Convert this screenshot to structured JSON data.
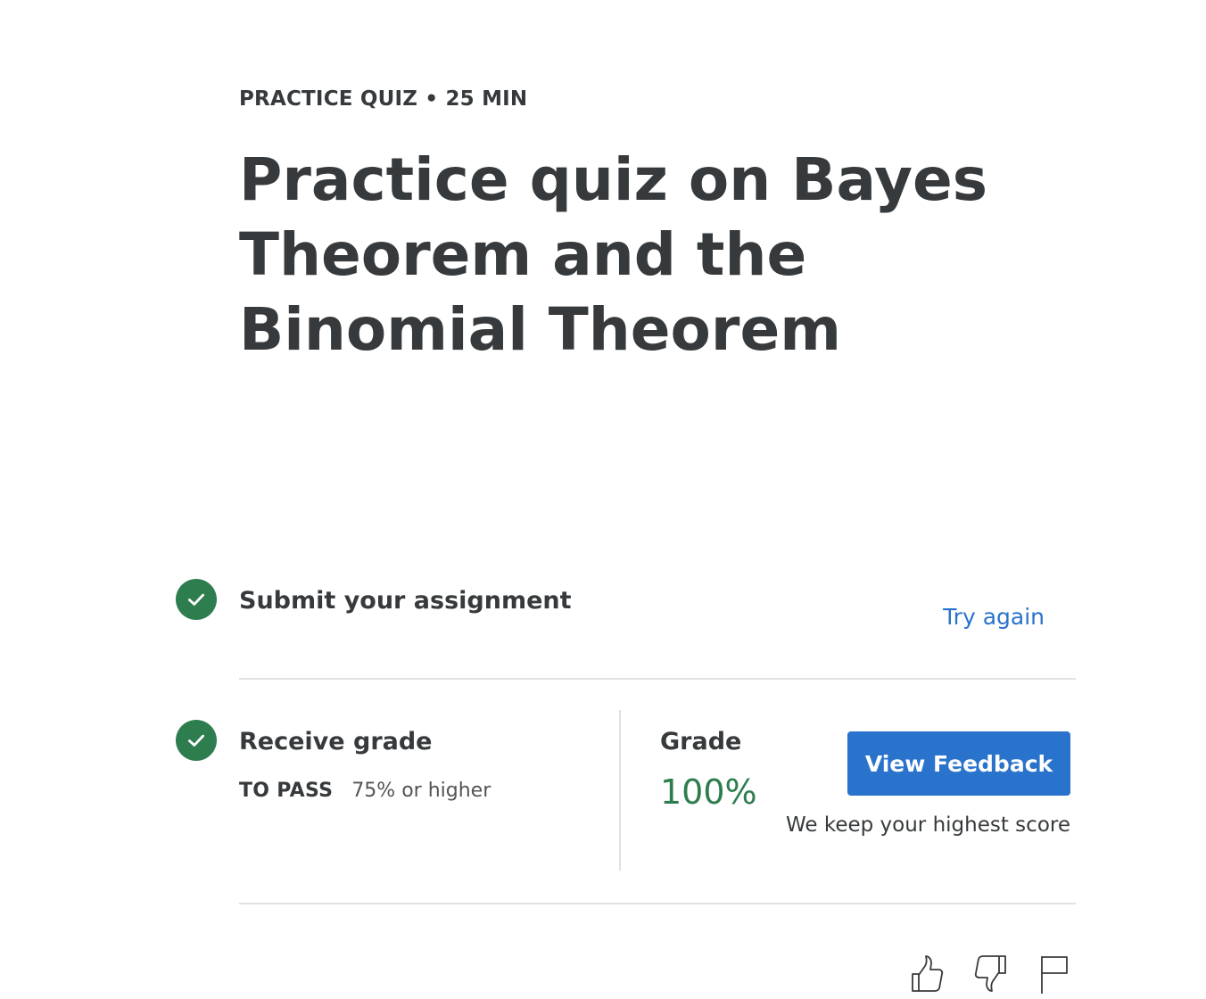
{
  "header": {
    "eyebrow": "PRACTICE QUIZ • 25 MIN",
    "title": "Practice quiz on Bayes Theorem and the Binomial Theorem"
  },
  "submit_step": {
    "label": "Submit your assignment",
    "action_label": "Try again",
    "status_icon": "check-circle-icon"
  },
  "grade_step": {
    "label": "Receive grade",
    "to_pass_label": "TO PASS",
    "to_pass_value": "75% or higher",
    "grade_label": "Grade",
    "grade_value": "100%",
    "status_icon": "check-circle-icon"
  },
  "feedback": {
    "button_label": "View Feedback",
    "note": "We keep your highest score"
  },
  "footer_actions": {
    "icons": [
      "thumbs-up-icon",
      "thumbs-down-icon",
      "flag-icon"
    ]
  },
  "colors": {
    "accent": "#2a73cc",
    "success": "#2e7d4f",
    "text": "#373a3c"
  }
}
